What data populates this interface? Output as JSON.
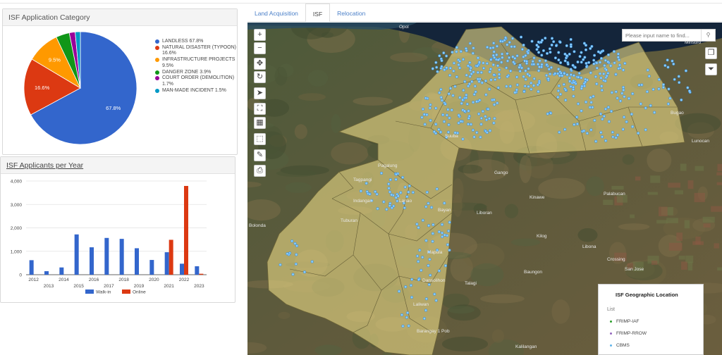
{
  "pie_panel": {
    "title": "ISF Application Category"
  },
  "bar_panel": {
    "title": "ISF Applicants per Year"
  },
  "chart_data": [
    {
      "type": "pie",
      "title": "ISF Application Category",
      "slices": [
        {
          "label": "LANDLESS",
          "value": 67.8,
          "color": "#3366cc",
          "legend_lines": [
            "LANDLESS 67.8%"
          ],
          "data_label": "67.8%"
        },
        {
          "label": "NATURAL DISASTER (TYPOON)",
          "value": 16.6,
          "color": "#dc3912",
          "legend_lines": [
            "NATURAL DISASTER (TYPOON)",
            "16.6%"
          ],
          "data_label": "16.6%"
        },
        {
          "label": "INFRASTRUCTURE PROJECTS",
          "value": 9.5,
          "color": "#ff9900",
          "legend_lines": [
            "INFRASTRUCTURE PROJECTS",
            "9.5%"
          ],
          "data_label": "9.5%"
        },
        {
          "label": "DANGER ZONE",
          "value": 3.9,
          "color": "#109618",
          "legend_lines": [
            "DANGER ZONE 3.9%"
          ],
          "data_label": ""
        },
        {
          "label": "COURT ORDER (DEMOLITION)",
          "value": 1.7,
          "color": "#990099",
          "legend_lines": [
            "COURT ORDER (DEMOLITION)",
            "1.7%"
          ],
          "data_label": ""
        },
        {
          "label": "MAN-MADE INCIDENT",
          "value": 1.5,
          "color": "#0099c6",
          "legend_lines": [
            "MAN-MADE INCIDENT 1.5%"
          ],
          "data_label": ""
        }
      ]
    },
    {
      "type": "bar",
      "title": "ISF Applicants per Year",
      "categories": [
        "2012",
        "2013",
        "2014",
        "2015",
        "2016",
        "2017",
        "2018",
        "2019",
        "2020",
        "2021",
        "2022",
        "2023"
      ],
      "series": [
        {
          "name": "Walk-in",
          "color": "#3366cc",
          "values": [
            620,
            150,
            310,
            1720,
            1170,
            1570,
            1530,
            1130,
            630,
            960,
            470,
            360
          ]
        },
        {
          "name": "Online",
          "color": "#dc3912",
          "values": [
            0,
            0,
            0,
            0,
            0,
            0,
            0,
            0,
            0,
            1490,
            3790,
            40
          ]
        }
      ],
      "ylim": [
        0,
        4000
      ],
      "yticks": [
        "0",
        "1,000",
        "2,000",
        "3,000",
        "4,000"
      ],
      "ytick_values": [
        0,
        1000,
        2000,
        3000,
        4000
      ],
      "grid": true,
      "legend": "bottom"
    }
  ],
  "map": {
    "tabs": [
      {
        "label": "Land Acquisition",
        "active": false
      },
      {
        "label": "ISF",
        "active": true
      },
      {
        "label": "Relocation",
        "active": false
      }
    ],
    "search_placeholder": "Please input name to find...",
    "place_labels": [
      {
        "text": "Opol"
      },
      {
        "text": "Minsuro"
      },
      {
        "text": "Bugao"
      },
      {
        "text": "Lunocan"
      },
      {
        "text": "Pagalung"
      },
      {
        "text": "Tagpangi"
      },
      {
        "text": "Gango"
      },
      {
        "text": "Kinawe"
      },
      {
        "text": "Palabucan"
      },
      {
        "text": "Indangan"
      },
      {
        "text": "Lanao"
      },
      {
        "text": "Bayan"
      },
      {
        "text": "Liboran"
      },
      {
        "text": "Kilog"
      },
      {
        "text": "Libona"
      },
      {
        "text": "Crossing"
      },
      {
        "text": "San Jose"
      },
      {
        "text": "Mapula"
      },
      {
        "text": "Baungon"
      },
      {
        "text": "Dansolihon"
      },
      {
        "text": "Talagi"
      },
      {
        "text": "Laliwan"
      },
      {
        "text": "Barangay 1 Pob"
      },
      {
        "text": "Kalilangan"
      },
      {
        "text": "Bolonda"
      },
      {
        "text": "Tuburan"
      },
      {
        "text": "Suuba"
      }
    ],
    "legend": {
      "title": "ISF Geographic Location",
      "subtitle": "List",
      "items": [
        {
          "label": "FRIMP-IAF",
          "color": "#2ca02c"
        },
        {
          "label": "FRIMP-RROW",
          "color": "#9467bd"
        },
        {
          "label": "CBMS",
          "color": "#5fb4ea"
        }
      ]
    },
    "toolbar": [
      {
        "name": "zoom-in-button",
        "glyph": "+"
      },
      {
        "name": "zoom-out-button",
        "glyph": "−"
      },
      {
        "name": "pan-button",
        "glyph": "✥"
      },
      {
        "name": "rotate-button",
        "glyph": "↻"
      },
      {
        "name": "compass-button",
        "glyph": "➤"
      },
      {
        "name": "full-extent-button",
        "glyph": "⛶"
      },
      {
        "name": "grid-button",
        "glyph": "▦"
      },
      {
        "name": "select-button",
        "glyph": "⬚"
      },
      {
        "name": "edit-button",
        "glyph": "✎"
      },
      {
        "name": "print-button",
        "glyph": "⎙"
      }
    ],
    "right_tools": [
      {
        "name": "layers-button",
        "glyph": "❐"
      },
      {
        "name": "filter-button",
        "glyph": "⏷"
      }
    ]
  }
}
